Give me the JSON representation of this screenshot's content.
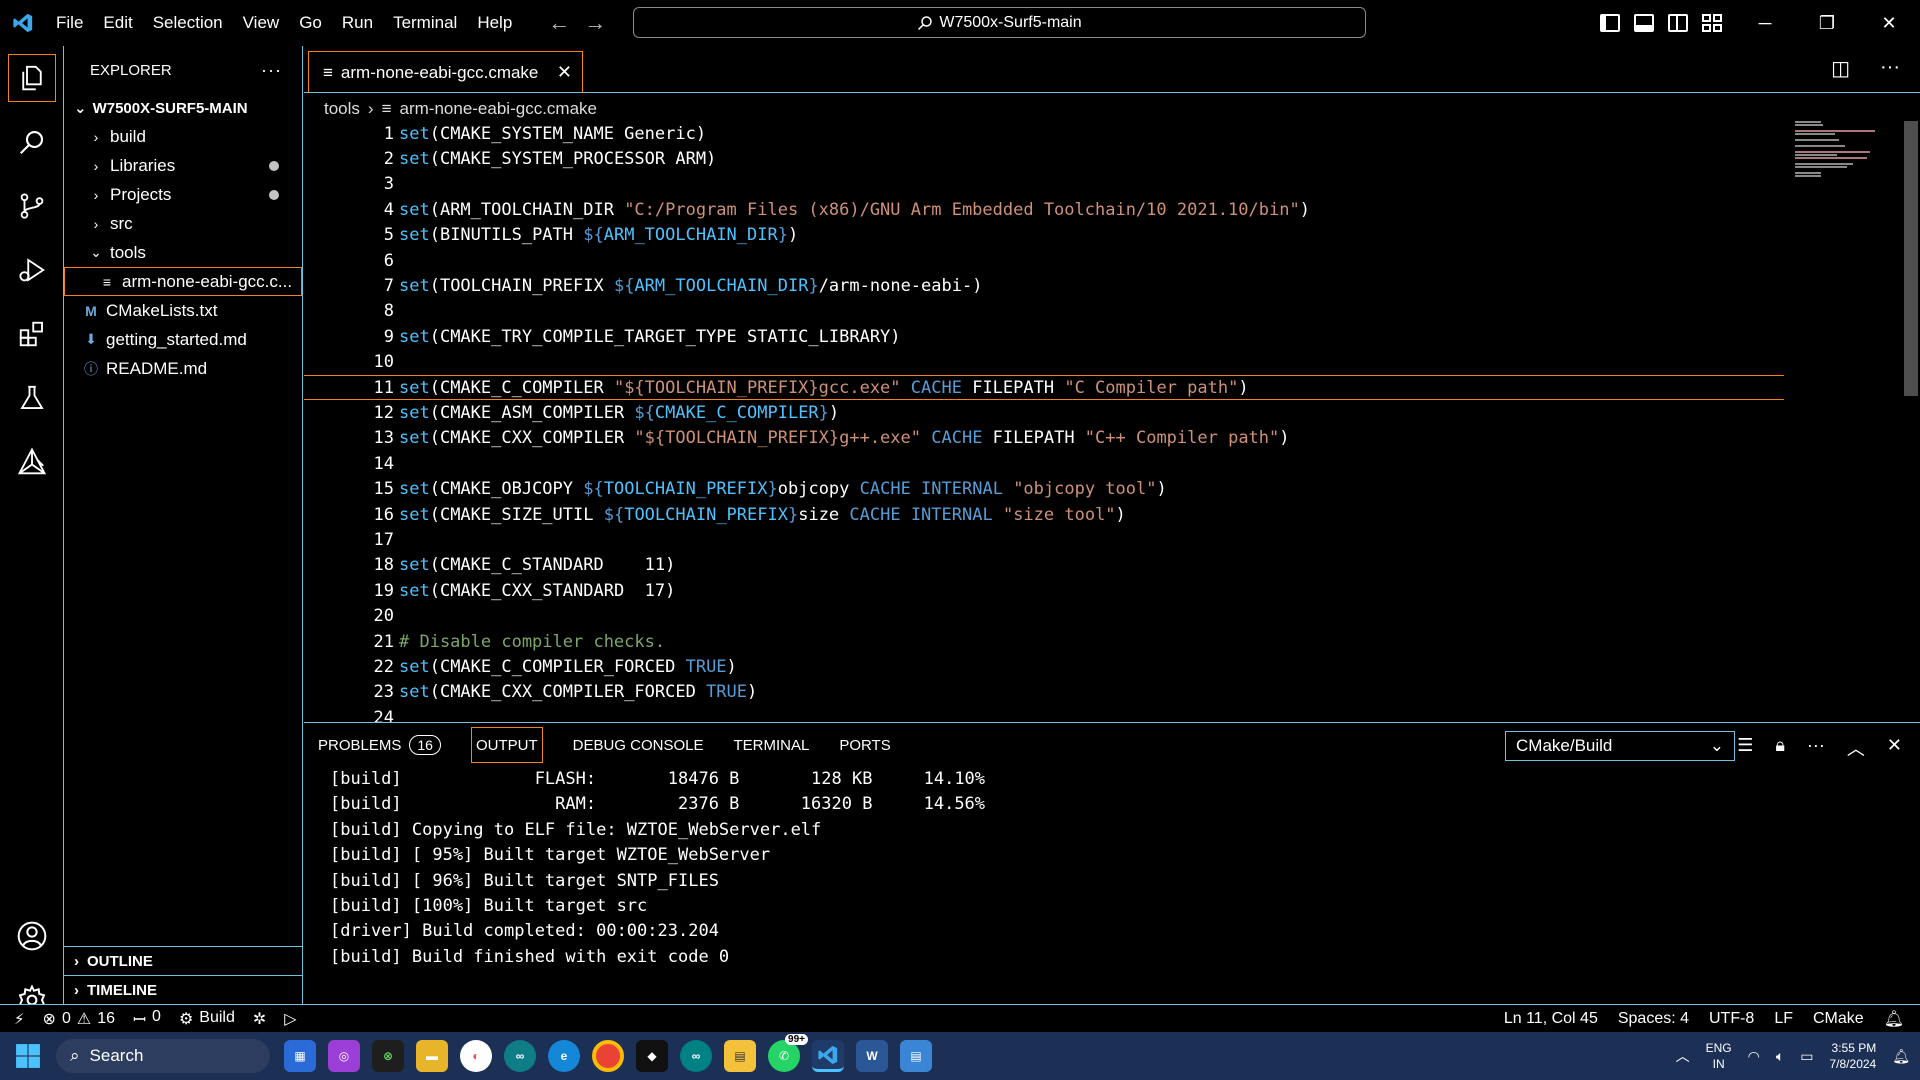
{
  "titlebar": {
    "menu": [
      "File",
      "Edit",
      "Selection",
      "View",
      "Go",
      "Run",
      "Terminal",
      "Help"
    ],
    "search": "W7500x-Surf5-main"
  },
  "sidebar": {
    "title": "EXPLORER",
    "more": "···",
    "root": "W7500X-SURF5-MAIN",
    "items": [
      {
        "label": "build",
        "type": "folder",
        "dot": false
      },
      {
        "label": "Libraries",
        "type": "folder",
        "dot": true
      },
      {
        "label": "Projects",
        "type": "folder",
        "dot": true
      },
      {
        "label": "src",
        "type": "folder",
        "dot": false
      },
      {
        "label": "tools",
        "type": "folder-open",
        "dot": false
      },
      {
        "label": "arm-none-eabi-gcc.c...",
        "type": "file",
        "dot": false
      },
      {
        "label": "CMakeLists.txt",
        "type": "file",
        "icon": "M",
        "dot": false
      },
      {
        "label": "getting_started.md",
        "type": "file",
        "icon": "⬇",
        "dot": false
      },
      {
        "label": "README.md",
        "type": "file",
        "icon": "ⓘ",
        "dot": false
      }
    ],
    "outline": "OUTLINE",
    "timeline": "TIMELINE"
  },
  "editor": {
    "tab": "arm-none-eabi-gcc.cmake",
    "breadcrumb": [
      "tools",
      "arm-none-eabi-gcc.cmake"
    ],
    "current_line": 11,
    "lines": [
      [
        [
          "fn",
          "set"
        ],
        [
          "plain",
          "(CMAKE_SYSTEM_NAME Generic)"
        ]
      ],
      [
        [
          "fn",
          "set"
        ],
        [
          "plain",
          "(CMAKE_SYSTEM_PROCESSOR ARM)"
        ]
      ],
      [],
      [
        [
          "fn",
          "set"
        ],
        [
          "plain",
          "(ARM_TOOLCHAIN_DIR "
        ],
        [
          "str",
          "\"C:/Program Files (x86)/GNU Arm Embedded Toolchain/10 2021.10/bin\""
        ],
        [
          "plain",
          ")"
        ]
      ],
      [
        [
          "fn",
          "set"
        ],
        [
          "plain",
          "(BINUTILS_PATH "
        ],
        [
          "kw",
          "${"
        ],
        [
          "fn",
          "ARM_TOOLCHAIN_DIR"
        ],
        [
          "kw",
          "}"
        ],
        [
          "plain",
          ")"
        ]
      ],
      [],
      [
        [
          "fn",
          "set"
        ],
        [
          "plain",
          "(TOOLCHAIN_PREFIX "
        ],
        [
          "kw",
          "${"
        ],
        [
          "fn",
          "ARM_TOOLCHAIN_DIR"
        ],
        [
          "kw",
          "}"
        ],
        [
          "plain",
          "/arm-none-eabi-)"
        ]
      ],
      [],
      [
        [
          "fn",
          "set"
        ],
        [
          "plain",
          "(CMAKE_TRY_COMPILE_TARGET_TYPE STATIC_LIBRARY)"
        ]
      ],
      [],
      [
        [
          "fn",
          "set"
        ],
        [
          "plain",
          "(CMAKE_C_COMPILER "
        ],
        [
          "str",
          "\"${TOOLCHAIN_PREFIX}gcc.exe\""
        ],
        [
          "plain",
          " "
        ],
        [
          "kw",
          "CACHE"
        ],
        [
          "plain",
          " FILEPATH "
        ],
        [
          "str",
          "\"C Compiler path\""
        ],
        [
          "plain",
          ")"
        ]
      ],
      [
        [
          "fn",
          "set"
        ],
        [
          "plain",
          "(CMAKE_ASM_COMPILER "
        ],
        [
          "kw",
          "${"
        ],
        [
          "fn",
          "CMAKE_C_COMPILER"
        ],
        [
          "kw",
          "}"
        ],
        [
          "plain",
          ")"
        ]
      ],
      [
        [
          "fn",
          "set"
        ],
        [
          "plain",
          "(CMAKE_CXX_COMPILER "
        ],
        [
          "str",
          "\"${TOOLCHAIN_PREFIX}g++.exe\""
        ],
        [
          "plain",
          " "
        ],
        [
          "kw",
          "CACHE"
        ],
        [
          "plain",
          " FILEPATH "
        ],
        [
          "str",
          "\"C++ Compiler path\""
        ],
        [
          "plain",
          ")"
        ]
      ],
      [],
      [
        [
          "fn",
          "set"
        ],
        [
          "plain",
          "(CMAKE_OBJCOPY "
        ],
        [
          "kw",
          "${"
        ],
        [
          "fn",
          "TOOLCHAIN_PREFIX"
        ],
        [
          "kw",
          "}"
        ],
        [
          "plain",
          "objcopy "
        ],
        [
          "kw",
          "CACHE INTERNAL"
        ],
        [
          "plain",
          " "
        ],
        [
          "str",
          "\"objcopy tool\""
        ],
        [
          "plain",
          ")"
        ]
      ],
      [
        [
          "fn",
          "set"
        ],
        [
          "plain",
          "(CMAKE_SIZE_UTIL "
        ],
        [
          "kw",
          "${"
        ],
        [
          "fn",
          "TOOLCHAIN_PREFIX"
        ],
        [
          "kw",
          "}"
        ],
        [
          "plain",
          "size "
        ],
        [
          "kw",
          "CACHE INTERNAL"
        ],
        [
          "plain",
          " "
        ],
        [
          "str",
          "\"size tool\""
        ],
        [
          "plain",
          ")"
        ]
      ],
      [],
      [
        [
          "fn",
          "set"
        ],
        [
          "plain",
          "(CMAKE_C_STANDARD    11)"
        ]
      ],
      [
        [
          "fn",
          "set"
        ],
        [
          "plain",
          "(CMAKE_CXX_STANDARD  17)"
        ]
      ],
      [],
      [
        [
          "cmt",
          "# Disable compiler checks."
        ]
      ],
      [
        [
          "fn",
          "set"
        ],
        [
          "plain",
          "(CMAKE_C_COMPILER_FORCED "
        ],
        [
          "kw",
          "TRUE"
        ],
        [
          "plain",
          ")"
        ]
      ],
      [
        [
          "fn",
          "set"
        ],
        [
          "plain",
          "(CMAKE_CXX_COMPILER_FORCED "
        ],
        [
          "kw",
          "TRUE"
        ],
        [
          "plain",
          ")"
        ]
      ],
      []
    ]
  },
  "panel": {
    "tabs": [
      "PROBLEMS",
      "OUTPUT",
      "DEBUG CONSOLE",
      "TERMINAL",
      "PORTS"
    ],
    "problems_count": "16",
    "active_tab": "OUTPUT",
    "channel": "CMake/Build",
    "output": [
      "[build]             FLASH:       18476 B       128 KB     14.10%",
      "[build]               RAM:        2376 B      16320 B     14.56%",
      "[build] Copying to ELF file: WZTOE_WebServer.elf",
      "[build] [ 95%] Built target WZTOE_WebServer",
      "[build] [ 96%] Built target SNTP_FILES",
      "[build] [100%] Built target src",
      "[driver] Build completed: 00:00:23.204",
      "[build] Build finished with exit code 0"
    ]
  },
  "statusbar": {
    "errors": "0",
    "warnings": "16",
    "ports": "0",
    "build": "Build",
    "position": "Ln 11, Col 45",
    "spaces": "Spaces: 4",
    "encoding": "UTF-8",
    "eol": "LF",
    "language": "CMake"
  },
  "taskbar": {
    "search": "Search",
    "whatsapp_badge": "99+",
    "lang_top": "ENG",
    "lang_bottom": "IN",
    "time": "3:55 PM",
    "date": "7/8/2024"
  }
}
